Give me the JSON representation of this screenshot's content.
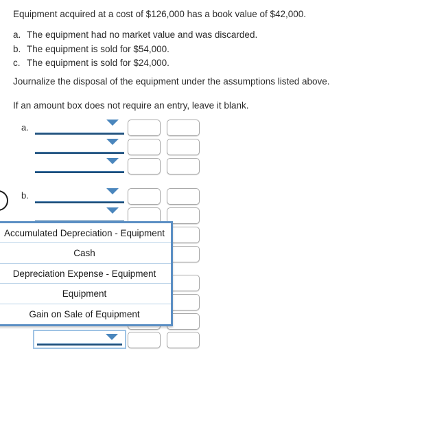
{
  "problem": {
    "intro": "Equipment acquired at a cost of $126,000 has a book value of $42,000.",
    "assumptions": [
      {
        "marker": "a.",
        "text": "The equipment had no market value and was discarded."
      },
      {
        "marker": "b.",
        "text": "The equipment is sold for $54,000."
      },
      {
        "marker": "c.",
        "text": "The equipment is sold for $24,000."
      }
    ],
    "instruction": "Journalize the disposal of the equipment under the assumptions listed above.",
    "note": "If an amount box does not require an entry, leave it blank."
  },
  "form": {
    "section_a_label": "a.",
    "section_b_label": "b.",
    "select_value": "",
    "amount_value": ""
  },
  "dropdown": {
    "open": true,
    "options": [
      "Accumulated Depreciation - Equipment",
      "Cash",
      "Depreciation Expense - Equipment",
      "Equipment",
      "Gain on Sale of Equipment"
    ]
  },
  "colors": {
    "rule": "#1f4f7a",
    "caret": "#4a86bd",
    "dropdown_border": "#5b8fc4",
    "focus_border": "#9fc3e4",
    "box_border": "#a9a9a9",
    "text": "#2a2a2a"
  }
}
